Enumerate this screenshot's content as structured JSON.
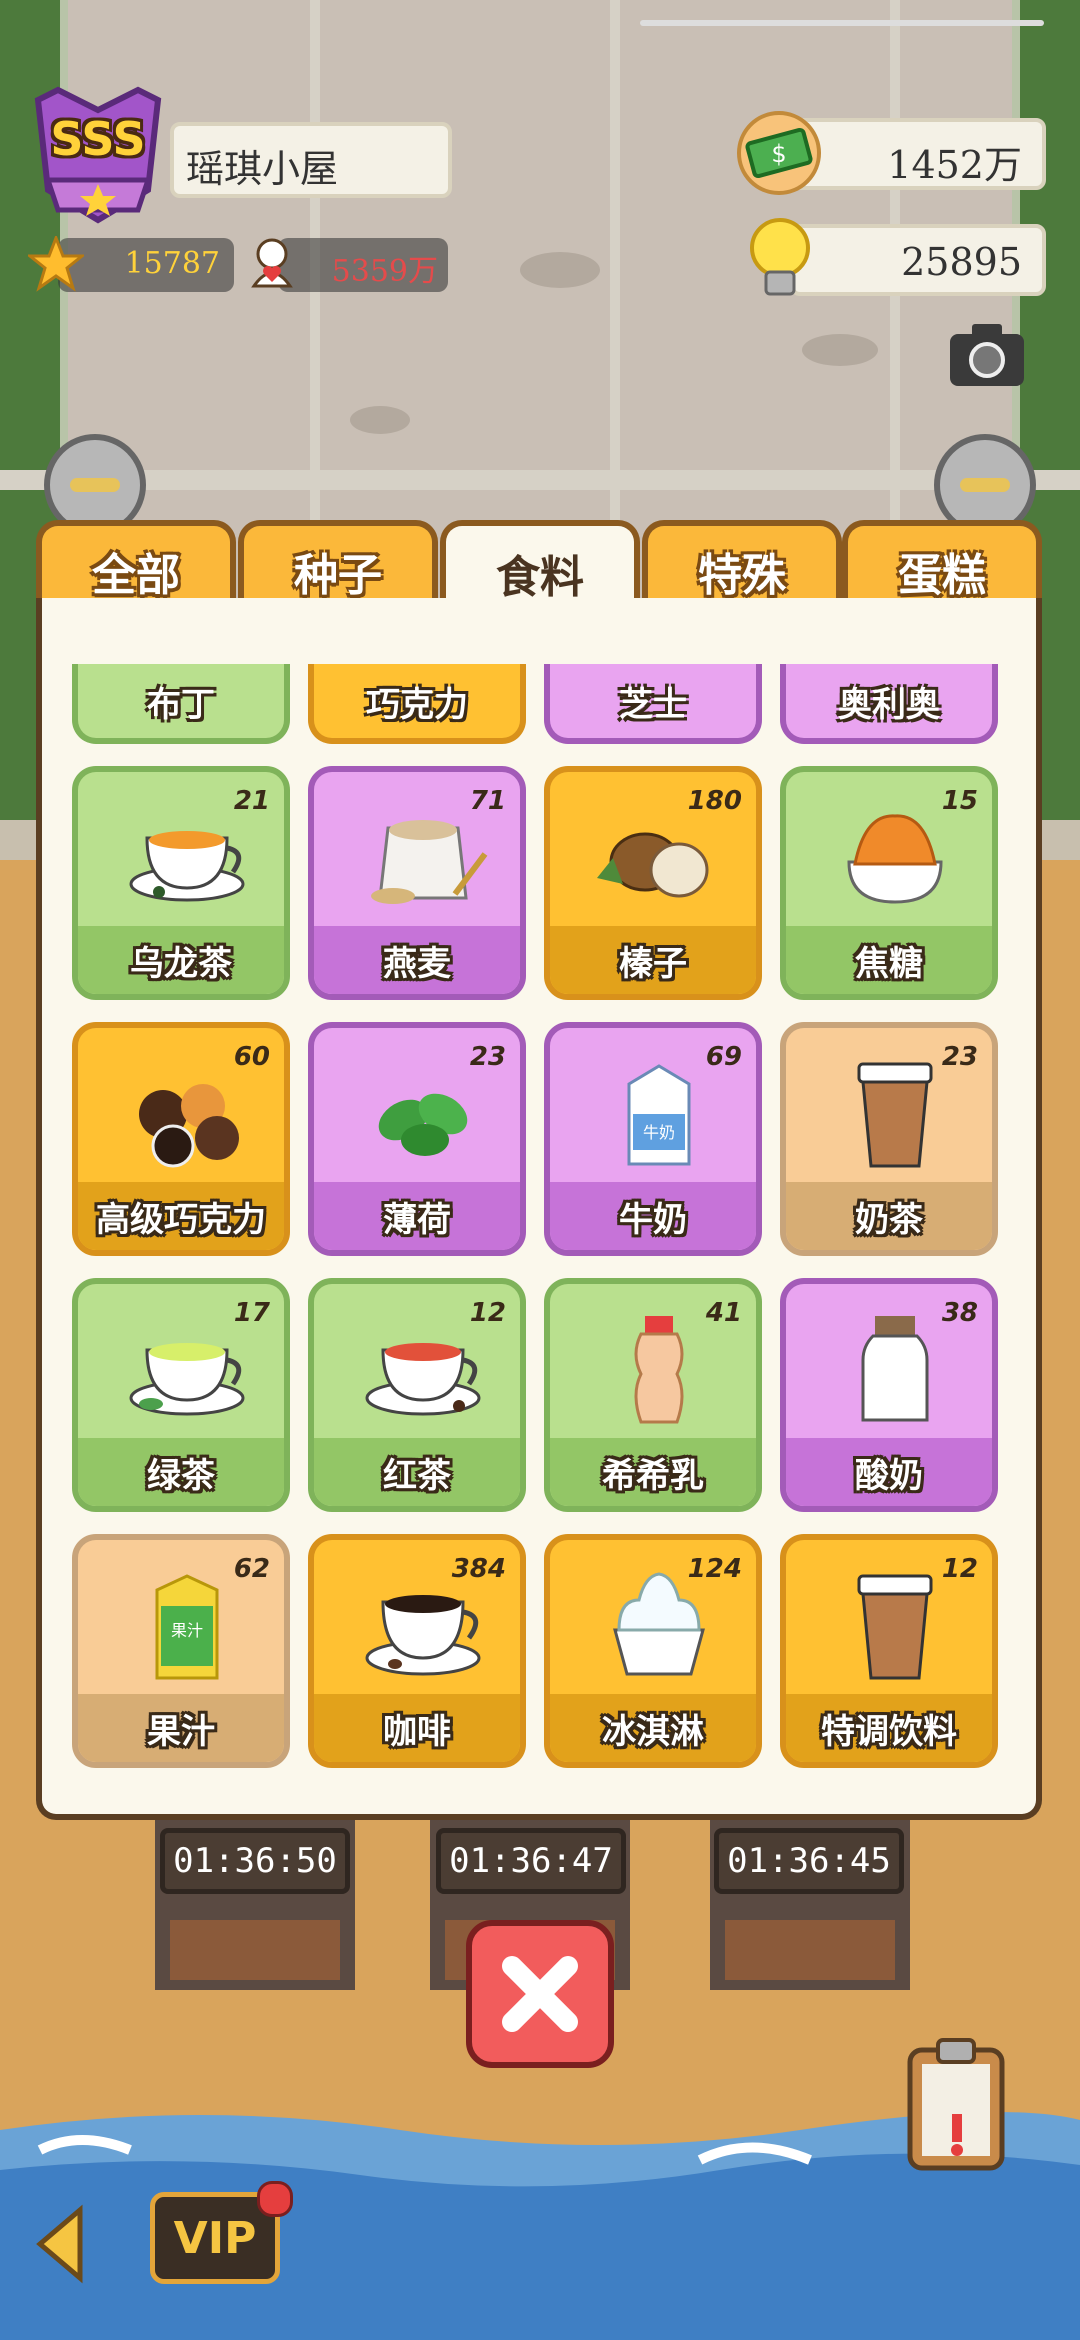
{
  "hud": {
    "rank_badge": "SSS",
    "shop_name": "瑶琪小屋",
    "stars": "15787",
    "fans": "5359万",
    "money": "1452万",
    "ideas": "25895",
    "icons": {
      "rank": "rank-badge-icon",
      "star": "star-icon",
      "fans": "fans-icon",
      "money": "money-icon",
      "idea": "lightbulb-icon",
      "camera": "camera-icon"
    }
  },
  "tabs": [
    {
      "label": "全部",
      "active": false
    },
    {
      "label": "种子",
      "active": false
    },
    {
      "label": "食料",
      "active": true
    },
    {
      "label": "特殊",
      "active": false
    },
    {
      "label": "蛋糕",
      "active": false
    }
  ],
  "partial_row": [
    {
      "label": "布丁",
      "color": "g"
    },
    {
      "label": "巧克力",
      "color": "o"
    },
    {
      "label": "芝士",
      "color": "p"
    },
    {
      "label": "奥利奥",
      "color": "p"
    }
  ],
  "items": [
    {
      "label": "乌龙茶",
      "count": "21",
      "color": "g",
      "icon": "oolong-tea-icon"
    },
    {
      "label": "燕麦",
      "count": "71",
      "color": "p",
      "icon": "oat-sack-icon"
    },
    {
      "label": "榛子",
      "count": "180",
      "color": "o",
      "icon": "hazelnut-icon"
    },
    {
      "label": "焦糖",
      "count": "15",
      "color": "g",
      "icon": "caramel-icon"
    },
    {
      "label": "高级巧克力",
      "count": "60",
      "color": "o",
      "icon": "premium-chocolate-icon"
    },
    {
      "label": "薄荷",
      "count": "23",
      "color": "p",
      "icon": "mint-icon"
    },
    {
      "label": "牛奶",
      "count": "69",
      "color": "p",
      "icon": "milk-carton-icon",
      "text_on_icon": "牛奶"
    },
    {
      "label": "奶茶",
      "count": "23",
      "color": "t",
      "icon": "milk-tea-cup-icon"
    },
    {
      "label": "绿茶",
      "count": "17",
      "color": "g",
      "icon": "green-tea-icon"
    },
    {
      "label": "红茶",
      "count": "12",
      "color": "g",
      "icon": "black-tea-icon"
    },
    {
      "label": "希希乳",
      "count": "41",
      "color": "g",
      "icon": "yakult-bottle-icon"
    },
    {
      "label": "酸奶",
      "count": "38",
      "color": "p",
      "icon": "yogurt-jar-icon"
    },
    {
      "label": "果汁",
      "count": "62",
      "color": "t",
      "icon": "juice-box-icon",
      "text_on_icon": "果汁"
    },
    {
      "label": "咖啡",
      "count": "384",
      "color": "o",
      "icon": "coffee-cup-icon"
    },
    {
      "label": "冰淇淋",
      "count": "124",
      "color": "o",
      "icon": "ice-cream-icon"
    },
    {
      "label": "特调饮料",
      "count": "12",
      "color": "o",
      "icon": "special-drink-icon"
    }
  ],
  "timers": [
    "01:36:50",
    "01:36:47",
    "01:36:45"
  ],
  "bottom": {
    "vip_label": "VIP"
  }
}
